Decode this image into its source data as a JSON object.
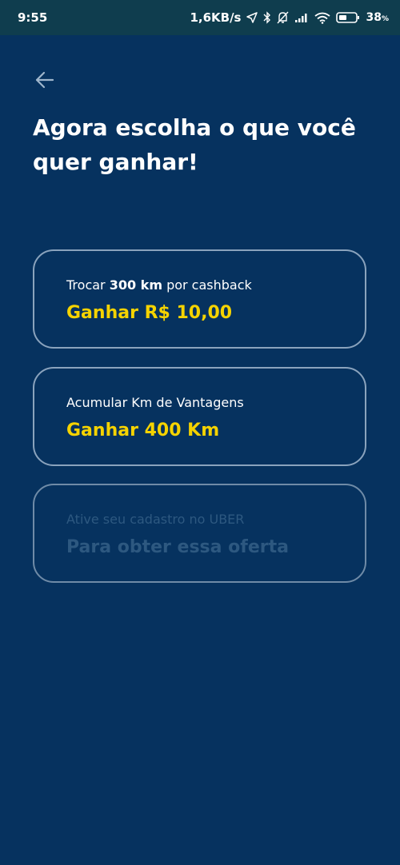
{
  "status_bar": {
    "time": "9:55",
    "network_speed": "1,6KB/s",
    "battery_percent": "38",
    "battery_symbol": "%",
    "icons": [
      "location-arrow-icon",
      "bluetooth-icon",
      "bell-off-icon",
      "signal-icon",
      "wifi-icon",
      "battery-icon"
    ]
  },
  "header": {
    "back_icon": "arrow-left-icon",
    "title_line1": "Agora escolha o que você",
    "title_line2": "quer ganhar!"
  },
  "options": [
    {
      "sub_prefix": "Trocar ",
      "sub_bold": "300 km",
      "sub_suffix": " por cashback",
      "main": "Ganhar R$ 10,00",
      "enabled": true
    },
    {
      "sub": "Acumular Km de Vantagens",
      "main": "Ganhar 400 Km",
      "enabled": true
    },
    {
      "sub": "Ative seu cadastro no UBER",
      "main": "Para obter essa oferta",
      "enabled": false
    }
  ],
  "colors": {
    "background": "#06325f",
    "status_bar": "#0f3d4e",
    "accent": "#f5d300",
    "card_border": "#8aa3bd",
    "disabled_text": "#2d5880"
  }
}
